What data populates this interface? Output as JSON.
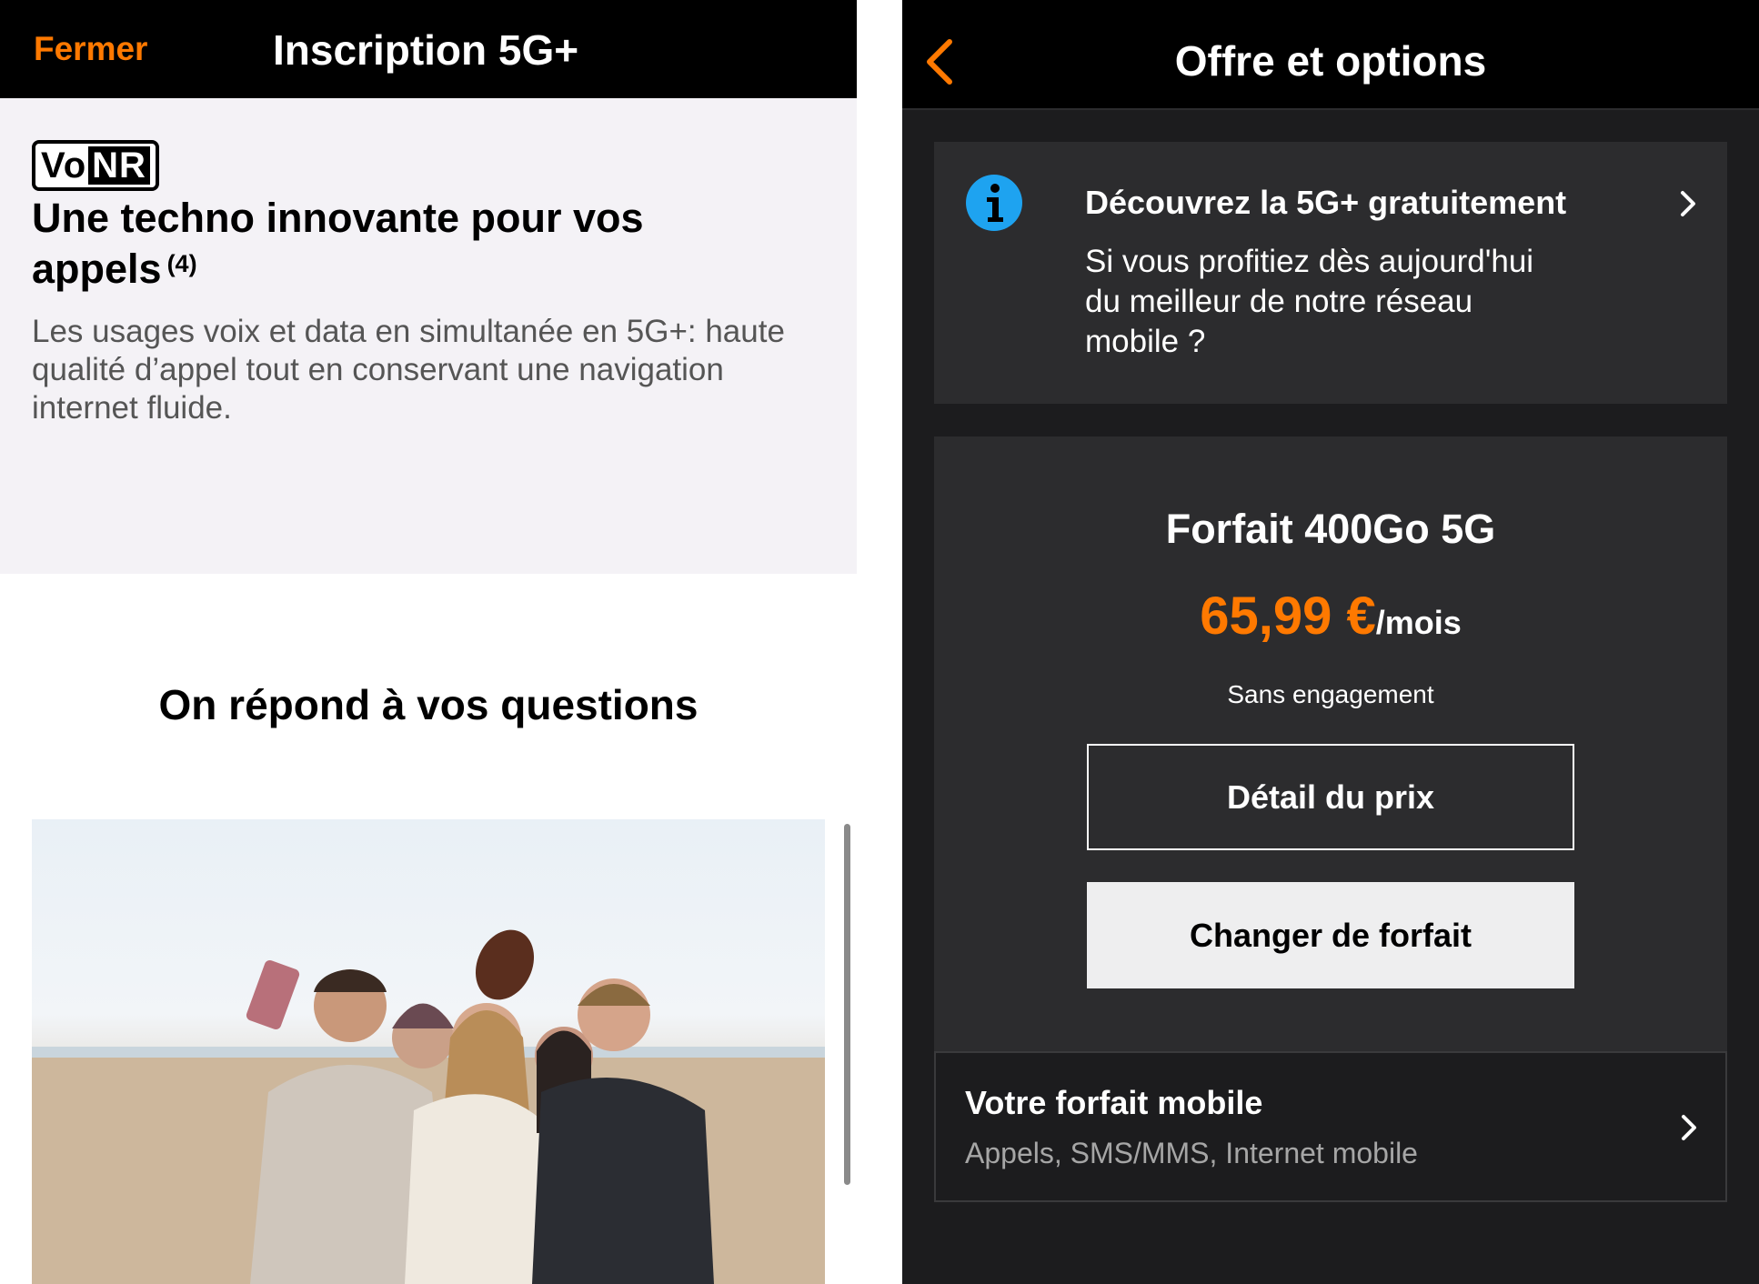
{
  "left_screen": {
    "close_label": "Fermer",
    "title": "Inscription 5G+",
    "feature": {
      "badge_vo": "Vo",
      "badge_nr": "NR",
      "title": "Une techno innovante pour vos appels",
      "footnote": "(4)",
      "description": "Les usages voix et data en simultanée en 5G+: haute qualité d’appel tout en conservant une navigation internet fluide."
    },
    "faq_title": "On répond à vos questions"
  },
  "right_screen": {
    "title": "Offre et options",
    "promo": {
      "title": "Découvrez la 5G+ gratuitement",
      "text": "Si vous profitiez dès aujourd'hui du meilleur de notre réseau mobile ?"
    },
    "plan": {
      "name": "Forfait 400Go 5G",
      "price": "65,99 €",
      "per": "/mois",
      "commitment": "Sans engagement",
      "detail_button": "Détail du prix",
      "change_button": "Changer de forfait"
    },
    "mobile_plan": {
      "title": "Votre forfait mobile",
      "subtitle": "Appels, SMS/MMS, Internet mobile"
    }
  },
  "colors": {
    "accent_orange": "#ff7900",
    "info_blue": "#1ea3f0",
    "dark_bg": "#1c1c1e",
    "card_bg": "#2c2c2e"
  },
  "icons": {
    "back": "chevron-left-icon",
    "info": "info-icon",
    "promo_arrow": "chevron-right-icon",
    "mobile_arrow": "chevron-right-icon"
  }
}
